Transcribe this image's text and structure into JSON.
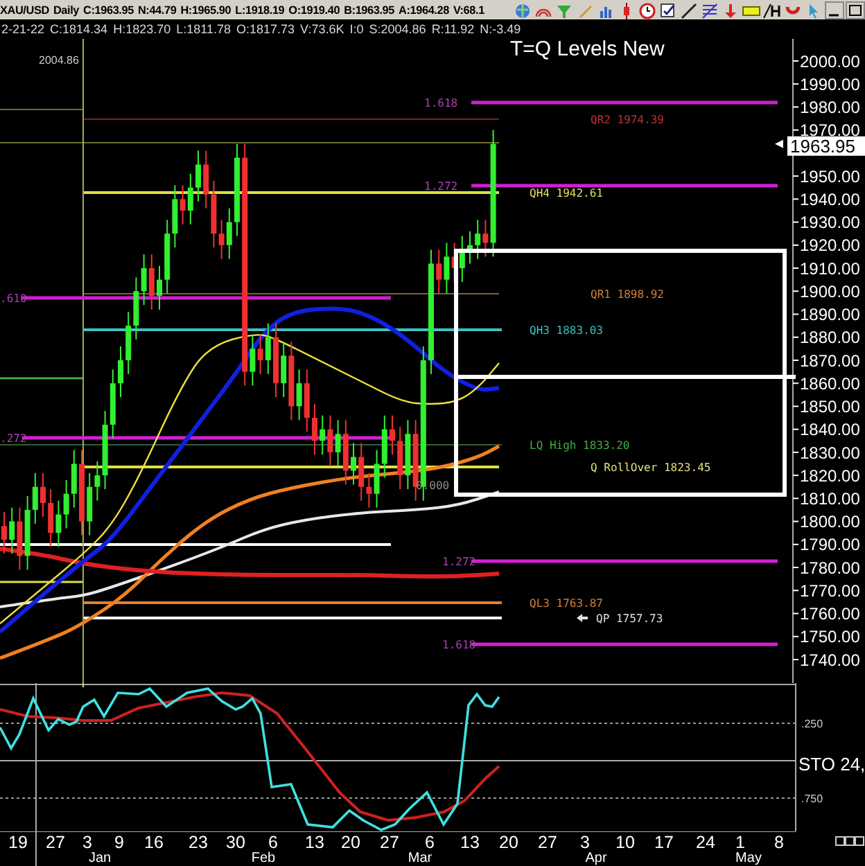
{
  "quote_bar": {
    "symbol": "XAU/USD",
    "period": "Daily",
    "values": [
      "C:1963.95",
      "N:44.79",
      "H:1965.90",
      "L:1918.19",
      "O:1919.40",
      "B:1963.95",
      "A:1964.28",
      "V:68.1"
    ]
  },
  "bar_info": [
    "2-21-22",
    "C:1814.34",
    "H:1823.70",
    "L:1811.78",
    "O:1817.73",
    "V:73.6K",
    "I:0",
    "S:2004.86",
    "R:11.92",
    "N:-3.49"
  ],
  "chart": {
    "title": "T=Q Levels New",
    "high_marker": "2004.86",
    "current_price": "1963.95",
    "levels": [
      {
        "text": "1.618",
        "kind": "fib",
        "color": "#b040b0"
      },
      {
        "text": "QR2 1974.39",
        "kind": "level",
        "color": "#c03030"
      },
      {
        "text": "1.272",
        "kind": "fib",
        "color": "#b040b0"
      },
      {
        "text": "QH4 1942.61",
        "kind": "level",
        "color": "#e0e060"
      },
      {
        "text": "QR1 1898.92",
        "kind": "level",
        "color": "#d08040"
      },
      {
        "text": ".610",
        "kind": "fib",
        "color": "#b040b0"
      },
      {
        "text": "QH3 1883.03",
        "kind": "level",
        "color": "#40c0c0"
      },
      {
        "text": ".272",
        "kind": "fib",
        "color": "#b040b0"
      },
      {
        "text": "LQ High 1833.20",
        "kind": "level",
        "color": "#40b040"
      },
      {
        "text": "Q RollOver 1823.45",
        "kind": "level",
        "color": "#e0e080"
      },
      {
        "text": "0.000",
        "kind": "fib",
        "color": "#909090"
      },
      {
        "text": "1.272",
        "kind": "fib",
        "color": "#b040b0"
      },
      {
        "text": "QL3 1763.87",
        "kind": "level",
        "color": "#d08040"
      },
      {
        "text": "QP 1757.73",
        "kind": "pointer",
        "color": "#e0e0e0"
      },
      {
        "text": "1.618",
        "kind": "fib",
        "color": "#b040b0"
      }
    ],
    "price_axis": [
      "2000.00",
      "1990.00",
      "1980.00",
      "1970.00",
      "1950.00",
      "1940.00",
      "1930.00",
      "1920.00",
      "1910.00",
      "1900.00",
      "1890.00",
      "1880.00",
      "1870.00",
      "1860.00",
      "1850.00",
      "1840.00",
      "1830.00",
      "1820.00",
      "1810.00",
      "1800.00",
      "1790.00",
      "1780.00",
      "1770.00",
      "1760.00",
      "1750.00",
      "1740.00"
    ]
  },
  "oscillator": {
    "name": "STO  24,",
    "levels": [
      ".250",
      ".750"
    ]
  },
  "date_axis": {
    "days": [
      "19",
      "27",
      "3",
      "9",
      "16",
      "23",
      "30",
      "6",
      "13",
      "20",
      "27",
      "6",
      "13",
      "20",
      "27",
      "3",
      "10",
      "17",
      "24",
      "1",
      "8"
    ],
    "months": [
      "Jan",
      "Feb",
      "Mar",
      "Apr",
      "May"
    ]
  }
}
